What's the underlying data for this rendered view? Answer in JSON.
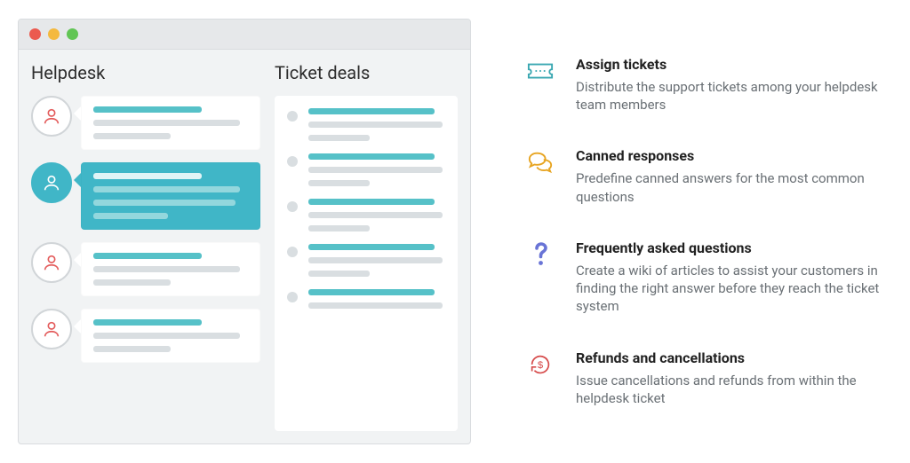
{
  "window": {
    "columns": {
      "left_title": "Helpdesk",
      "right_title": "Ticket deals"
    }
  },
  "features": [
    {
      "icon": "ticket-icon",
      "title": "Assign tickets",
      "description": "Distribute the support tickets among your helpdesk team members"
    },
    {
      "icon": "chat-bubbles-icon",
      "title": "Canned responses",
      "description": "Predefine canned answers for the most common questions"
    },
    {
      "icon": "question-icon",
      "title": "Frequently asked questions",
      "description": "Create a wiki of articles to assist your customers in finding the right answer before they reach the ticket system"
    },
    {
      "icon": "refund-icon",
      "title": "Refunds and cancellations",
      "description": "Issue cancellations and refunds from within the helpdesk ticket"
    }
  ]
}
